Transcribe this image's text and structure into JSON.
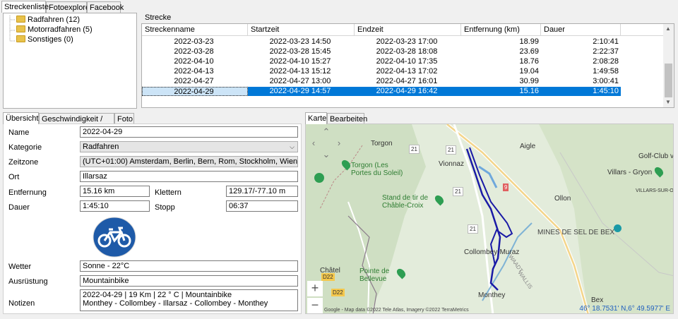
{
  "top_tabs": [
    "Streckenliste",
    "Fotoexplorer",
    "Facebook"
  ],
  "tree": [
    {
      "label": "Radfahren (12)"
    },
    {
      "label": "Motorradfahren (5)"
    },
    {
      "label": "Sonstiges (0)"
    }
  ],
  "strecke": {
    "group_label": "Strecke",
    "columns": [
      "Streckenname",
      "Startzeit",
      "Endzeit",
      "Entfernung (km)",
      "Dauer"
    ],
    "rows": [
      {
        "name": "2022-03-23",
        "start": "2022-03-23 14:50",
        "end": "2022-03-23 17:00",
        "dist": "18.99",
        "dur": "2:10:41"
      },
      {
        "name": "2022-03-28",
        "start": "2022-03-28 15:45",
        "end": "2022-03-28 18:08",
        "dist": "23.69",
        "dur": "2:22:37"
      },
      {
        "name": "2022-04-10",
        "start": "2022-04-10 15:27",
        "end": "2022-04-10 17:35",
        "dist": "18.76",
        "dur": "2:08:28"
      },
      {
        "name": "2022-04-13",
        "start": "2022-04-13 15:12",
        "end": "2022-04-13 17:02",
        "dist": "19.04",
        "dur": "1:49:58"
      },
      {
        "name": "2022-04-27",
        "start": "2022-04-27 13:00",
        "end": "2022-04-27 16:01",
        "dist": "30.99",
        "dur": "3:00:41"
      },
      {
        "name": "2022-04-29",
        "start": "2022-04-29 14:57",
        "end": "2022-04-29 16:42",
        "dist": "15.16",
        "dur": "1:45:10"
      }
    ]
  },
  "detail_tabs": [
    "Übersicht",
    "Geschwindigkeit / Höhe",
    "Foto"
  ],
  "form": {
    "name_label": "Name",
    "name_value": "2022-04-29",
    "category_label": "Kategorie",
    "category_value": "Radfahren",
    "timezone_label": "Zeitzone",
    "timezone_value": "(UTC+01:00) Amsterdam, Berlin, Bern, Rom, Stockholm, Wien",
    "place_label": "Ort",
    "place_value": "Illarsaz",
    "distance_label": "Entfernung",
    "distance_value": "15.16 km",
    "climb_label": "Klettern",
    "climb_value": "129.17/-77.10 m",
    "duration_label": "Dauer",
    "duration_value": "1:45:10",
    "stop_label": "Stopp",
    "stop_value": "06:37",
    "weather_label": "Wetter",
    "weather_value": "Sonne  -  22°C",
    "equipment_label": "Ausrüstung",
    "equipment_value": "Mountainbike",
    "notes_label": "Notizen",
    "notes_line1": "2022-04-29  | 19 Km | 22 ° C | Mountainbike",
    "notes_line2": "Monthey - Collombey - Illarsaz - Collombey - Monthey"
  },
  "map_tabs": [
    "Karte",
    "Bearbeiten"
  ],
  "map": {
    "places": [
      "Torgon",
      "Aigle",
      "Vionnaz",
      "Golf-Club v",
      "Villars - Gryon",
      "VILLARS-SUR-OL",
      "Ollon",
      "Collombey-Muraz",
      "MINES DE SEL DE BEX",
      "Châtel",
      "Monthey",
      "Bex"
    ],
    "pois": [
      "Torgon (Les Portes du Soleil)",
      "Stand de tir de Châble-Croix",
      "Pointe de Bellevue"
    ],
    "roads": [
      "21",
      "21",
      "21",
      "21",
      "9",
      "D22",
      "D22",
      "WAADT",
      "WALLIS"
    ],
    "attribution": "Google - Map data ©2022 Tele Atlas, Imagery ©2022 TerraMetrics",
    "coords": "46° 18.7531' N,6° 49.5977' E",
    "accent": "#1a1aa6"
  }
}
